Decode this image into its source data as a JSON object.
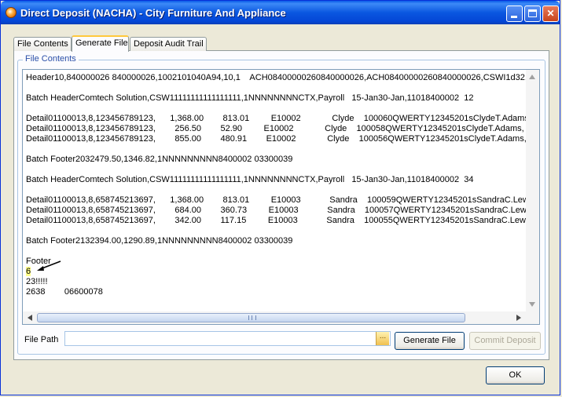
{
  "window": {
    "title": "Direct Deposit (NACHA) - City Furniture And Appliance"
  },
  "tabs": [
    {
      "label": "File Contents",
      "active": false
    },
    {
      "label": "Generate File",
      "active": true
    },
    {
      "label": "Deposit Audit Trail",
      "active": false
    }
  ],
  "group": {
    "label": "File Contents"
  },
  "file_contents": {
    "lines": [
      "Header10,840000026 840000026,1002101040A94,10,1    ACH08400000260840000026,ACH08400000260840000026,CSWI1d32,",
      "",
      "Batch HeaderComtech Solution,CSW11111111111111111,1NNNNNNNNCTX,Payroll   15-Jan30-Jan,11018400002  12",
      "",
      "Detail01100013,8,123456789123,      1,368.00        813.01         E10002             Clyde    100060QWERTY12345201sClydeT.Adams,",
      "Detail01100013,8,123456789123,        256.50        52.90         E10002             Clyde    100058QWERTY12345201sClydeT.Adams,",
      "Detail01100013,8,123456789123,        855.00        480.91        E10002             Clyde    100056QWERTY12345201sClydeT.Adams,",
      "",
      "Batch Footer2032479.50,1346.82,1NNNNNNNNN8400002 03300039",
      "",
      "Batch HeaderComtech Solution,CSW11111111111111111,1NNNNNNNNCTX,Payroll   15-Jan30-Jan,11018400002  34",
      "",
      "Detail01100013,8,658745213697,      1,368.00        813.01         E10003            Sandra    100059QWERTY12345201sSandraC.Lew",
      "Detail01100013,8,658745213697,        684.00        360.73         E10003            Sandra    100057QWERTY12345201sSandraC.Lew",
      "Detail01100013,8,658745213697,        342.00        117.15         E10003            Sandra    100055QWERTY12345201sSandraC.Lew",
      "",
      "Batch Footer2132394.00,1290.89,1NNNNNNNNN8400002 03300039",
      "",
      "Footer",
      "6",
      "23!!!!!",
      "2638        06600078"
    ],
    "highlighted_line": 19
  },
  "file_path": {
    "label": "File Path",
    "value": "",
    "browse_label": "..."
  },
  "buttons": {
    "generate": "Generate File",
    "commit": "Commit Deposit",
    "ok": "OK"
  },
  "icons": {
    "app": "app-orb-icon",
    "minimize": "minimize-icon",
    "maximize": "maximize-icon",
    "close": "close-icon",
    "annotation": "arrow-icon"
  },
  "colors": {
    "title_bar": "#0a57e0",
    "active_tab_accent": "#ffc83c",
    "highlight": "#ffff8a",
    "group_label": "#2a4fa8"
  }
}
